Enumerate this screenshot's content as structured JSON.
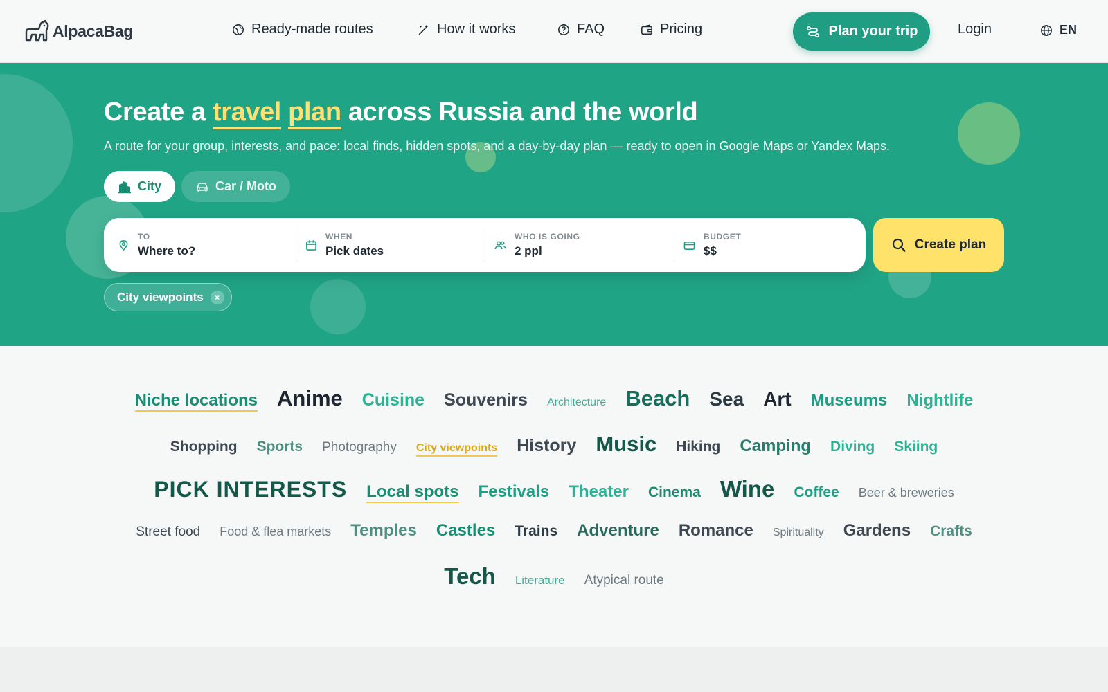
{
  "header": {
    "logo_text": "AlpacaBag",
    "nav": [
      {
        "label": "Ready-made routes",
        "icon": "globe-icon"
      },
      {
        "label": "How it works",
        "icon": "magic-wand-icon"
      },
      {
        "label": "FAQ",
        "icon": "question-icon"
      },
      {
        "label": "Pricing",
        "icon": "wallet-icon"
      }
    ],
    "cta_label": "Plan your trip",
    "login_label": "Login",
    "lang_label": "EN"
  },
  "hero": {
    "title_prefix": "Create a",
    "title_highlight_1": "travel",
    "title_highlight_2": "plan",
    "title_suffix": "across Russia and the world",
    "subtitle": "A route for your group, interests, and pace: local finds, hidden spots, and a day-by-day plan — ready to open in Google Maps or Yandex Maps.",
    "modes": [
      {
        "label": "City",
        "active": true
      },
      {
        "label": "Car / Moto",
        "active": false
      }
    ],
    "search": {
      "to": {
        "label": "TO",
        "value": "Where to?"
      },
      "when": {
        "label": "WHEN",
        "value": "Pick dates"
      },
      "who": {
        "label": "WHO IS GOING",
        "value": "2 ppl"
      },
      "budget": {
        "label": "BUDGET",
        "value": "$$"
      }
    },
    "create_label": "Create plan",
    "chip_label": "City viewpoints",
    "chip_close": "×"
  },
  "colors": {
    "brand_green": "#20a486",
    "accent_yellow": "#ffe26a"
  },
  "tags": {
    "row1": [
      "Niche locations",
      "Anime",
      "Cuisine",
      "Souvenirs",
      "Architecture",
      "Beach",
      "Sea",
      "Art",
      "Museums",
      "Nightlife"
    ],
    "row2": [
      "Shopping",
      "Sports",
      "Photography",
      "City viewpoints",
      "History",
      "Music",
      "Hiking",
      "Camping",
      "Diving",
      "Skiing"
    ],
    "row3": [
      "PICK INTERESTS",
      "Local spots",
      "Festivals",
      "Theater",
      "Cinema",
      "Wine",
      "Coffee",
      "Beer & breweries"
    ],
    "row4": [
      "Street food",
      "Food & flea markets",
      "Temples",
      "Castles",
      "Trains",
      "Adventure",
      "Romance",
      "Spirituality",
      "Gardens",
      "Crafts"
    ],
    "row5": [
      "Tech",
      "Literature",
      "Atypical route"
    ]
  }
}
